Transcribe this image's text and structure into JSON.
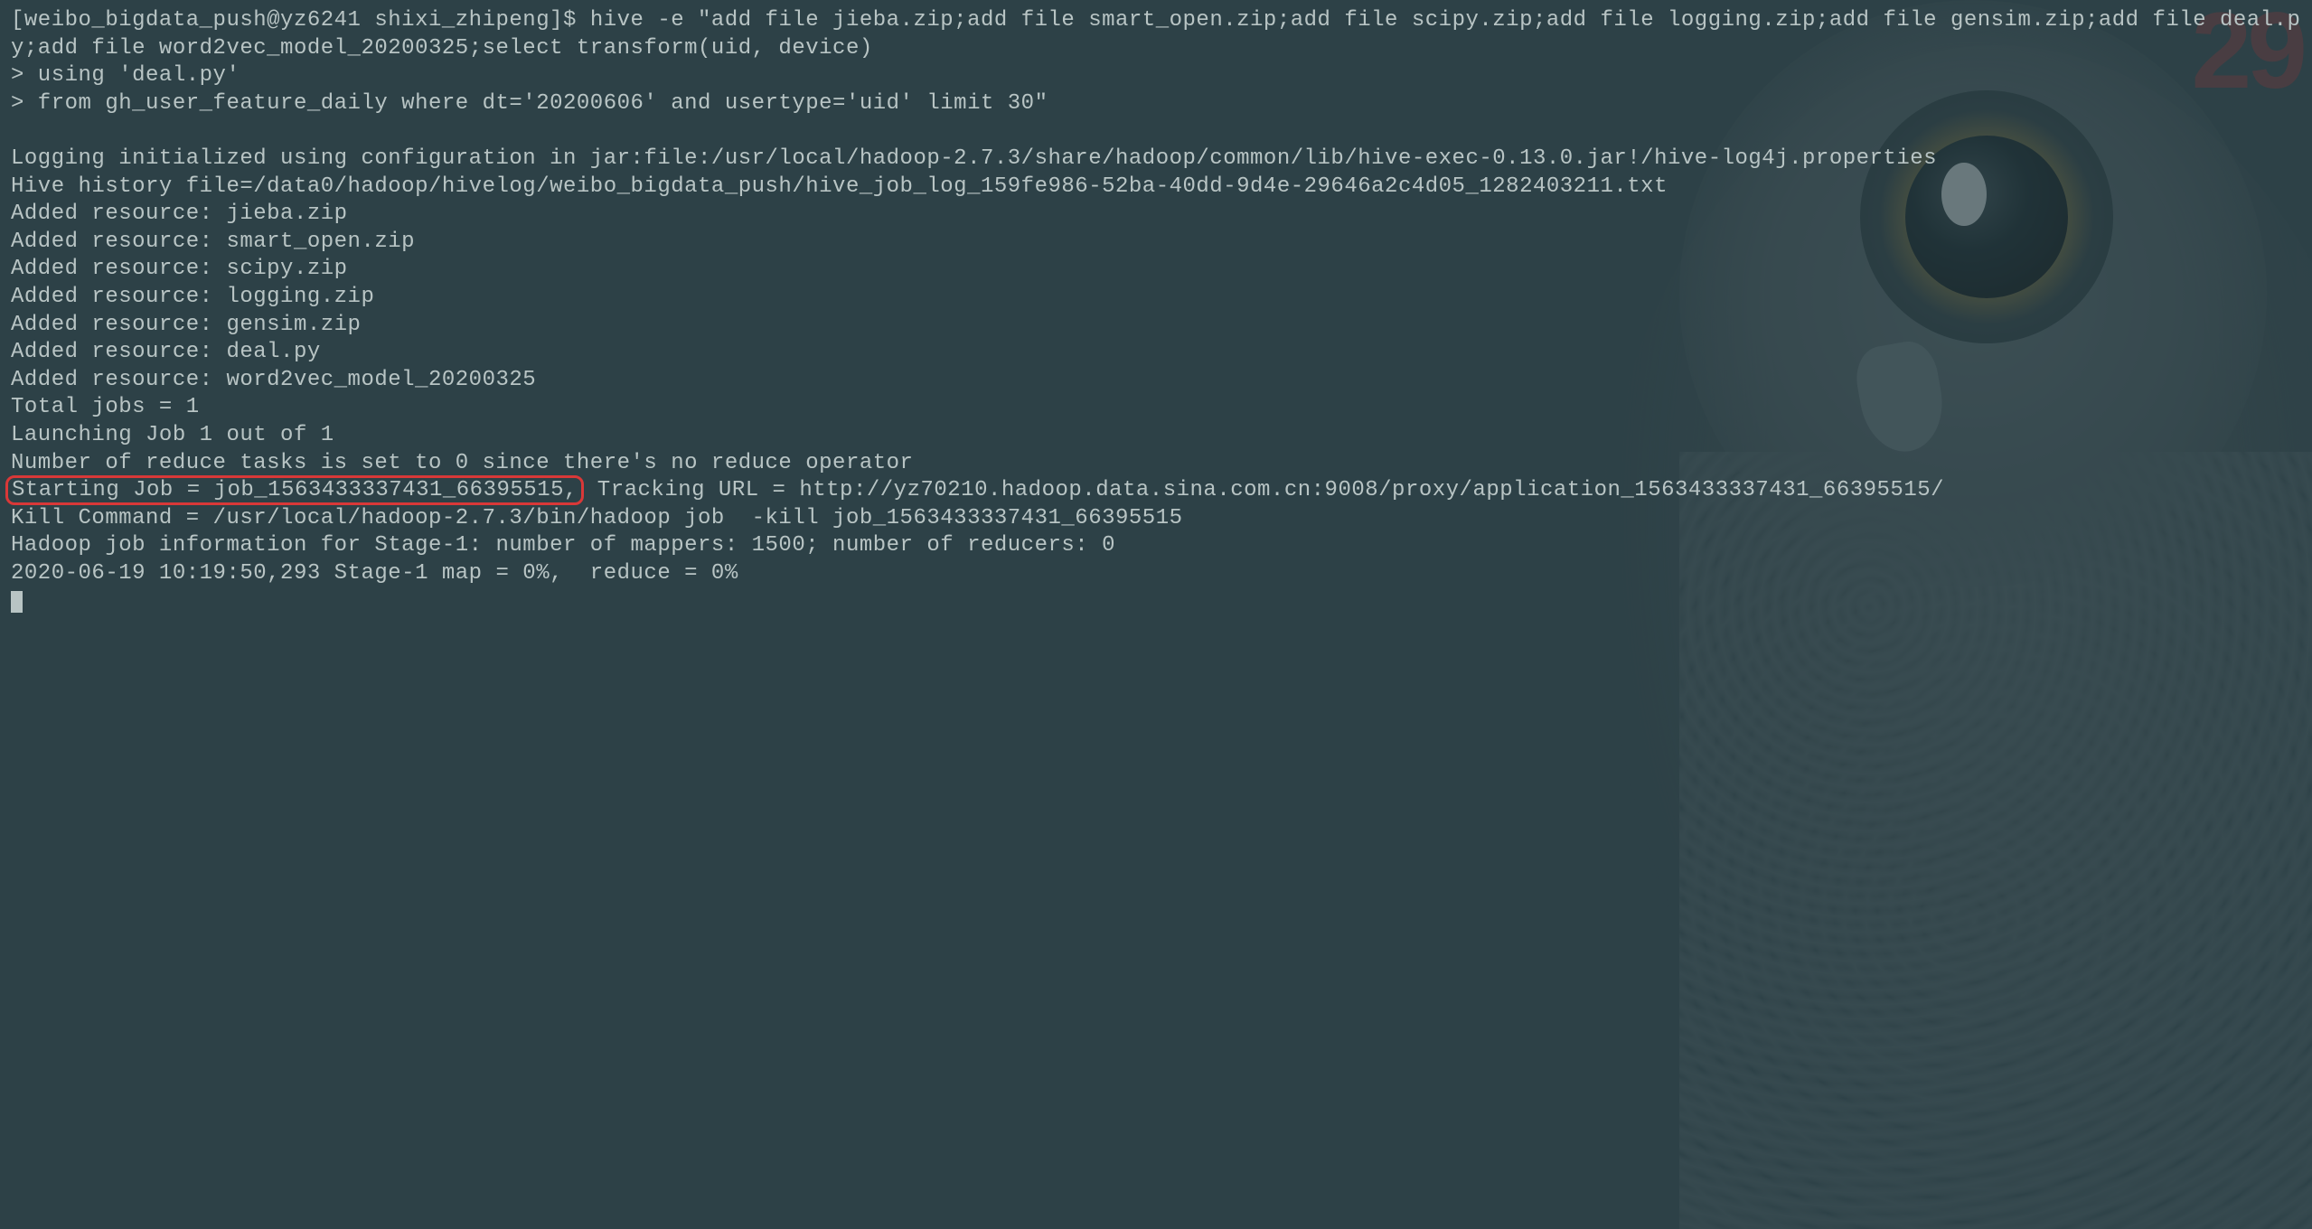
{
  "prompt": "[weibo_bigdata_push@yz6241 shixi_zhipeng]$ ",
  "command": "hive -e \"add file jieba.zip;add file smart_open.zip;add file scipy.zip;add file logging.zip;add file gensim.zip;add file deal.py;add file word2vec_model_20200325;select transform(uid, device)",
  "continuation1": "> using 'deal.py'",
  "continuation2": "> from gh_user_feature_daily where dt='20200606' and usertype='uid' limit 30\"",
  "blank": "",
  "logging_line": "Logging initialized using configuration in jar:file:/usr/local/hadoop-2.7.3/share/hadoop/common/lib/hive-exec-0.13.0.jar!/hive-log4j.properties",
  "history_line": "Hive history file=/data0/hadoop/hivelog/weibo_bigdata_push/hive_job_log_159fe986-52ba-40dd-9d4e-29646a2c4d05_1282403211.txt",
  "added_resources": [
    "Added resource: jieba.zip",
    "Added resource: smart_open.zip",
    "Added resource: scipy.zip",
    "Added resource: logging.zip",
    "Added resource: gensim.zip",
    "Added resource: deal.py",
    "Added resource: word2vec_model_20200325"
  ],
  "total_jobs": "Total jobs = 1",
  "launching": "Launching Job 1 out of 1",
  "reduce_tasks": "Number of reduce tasks is set to 0 since there's no reduce operator",
  "starting_job_highlight": "Starting Job = job_1563433337431_66395515,",
  "tracking_url": " Tracking URL = http://yz70210.hadoop.data.sina.com.cn:9008/proxy/application_1563433337431_66395515/",
  "kill_command": "Kill Command = /usr/local/hadoop-2.7.3/bin/hadoop job  -kill job_1563433337431_66395515",
  "hadoop_info": "Hadoop job information for Stage-1: number of mappers: 1500; number of reducers: 0",
  "progress": "2020-06-19 10:19:50,293 Stage-1 map = 0%,  reduce = 0%",
  "watermark": "29"
}
